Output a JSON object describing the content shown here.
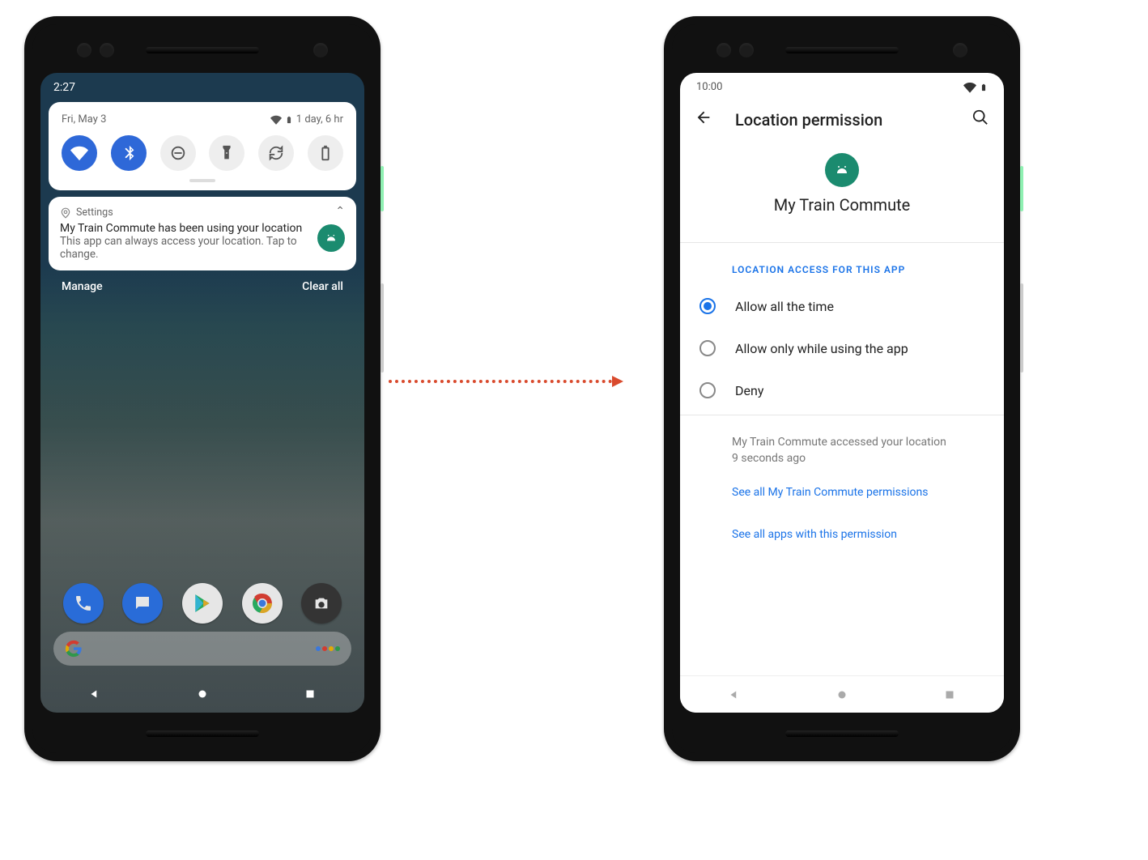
{
  "left": {
    "status_time": "2:27",
    "qs": {
      "date": "Fri, May 3",
      "batt_text": "1 day, 6 hr",
      "tiles": [
        {
          "name": "wifi-icon",
          "on": true
        },
        {
          "name": "bluetooth-icon",
          "on": true
        },
        {
          "name": "dnd-icon",
          "on": false
        },
        {
          "name": "flashlight-icon",
          "on": false
        },
        {
          "name": "rotate-icon",
          "on": false
        },
        {
          "name": "battery-saver-icon",
          "on": false
        }
      ]
    },
    "notif": {
      "app": "Settings",
      "title": "My Train Commute has been using your location",
      "body": "This app can always access your location. Tap to change."
    },
    "foot_manage": "Manage",
    "foot_clear": "Clear all",
    "dock": [
      "phone-icon",
      "messages-icon",
      "play-icon",
      "chrome-icon",
      "camera-icon"
    ]
  },
  "right": {
    "status_time": "10:00",
    "appbar_title": "Location permission",
    "app_name": "My Train Commute",
    "section_label": "LOCATION ACCESS FOR THIS APP",
    "options": [
      {
        "label": "Allow all the time",
        "selected": true
      },
      {
        "label": "Allow only while using the app",
        "selected": false
      },
      {
        "label": "Deny",
        "selected": false
      }
    ],
    "info": "My Train Commute accessed your location 9 seconds ago",
    "link1": "See all My Train Commute permissions",
    "link2": "See all apps with this permission"
  }
}
